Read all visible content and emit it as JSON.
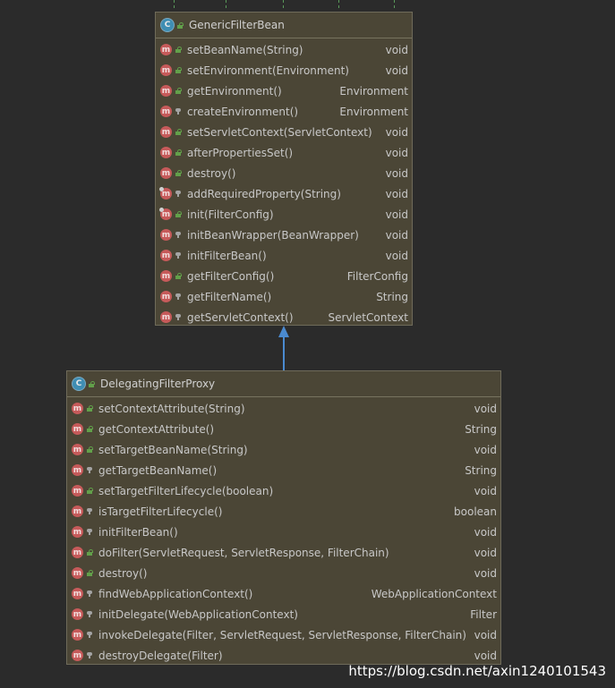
{
  "parent": {
    "name": "GenericFilterBean",
    "kind_glyph": "C",
    "members": [
      {
        "name": "setBeanName(String)",
        "type": "void",
        "access": "open",
        "override": false
      },
      {
        "name": "setEnvironment(Environment)",
        "type": "void",
        "access": "open",
        "override": false
      },
      {
        "name": "getEnvironment()",
        "type": "Environment",
        "access": "open",
        "override": false
      },
      {
        "name": "createEnvironment()",
        "type": "Environment",
        "access": "lock",
        "override": false
      },
      {
        "name": "setServletContext(ServletContext)",
        "type": "void",
        "access": "open",
        "override": false
      },
      {
        "name": "afterPropertiesSet()",
        "type": "void",
        "access": "open",
        "override": false
      },
      {
        "name": "destroy()",
        "type": "void",
        "access": "open",
        "override": false
      },
      {
        "name": "addRequiredProperty(String)",
        "type": "void",
        "access": "lock",
        "override": true
      },
      {
        "name": "init(FilterConfig)",
        "type": "void",
        "access": "open",
        "override": true
      },
      {
        "name": "initBeanWrapper(BeanWrapper)",
        "type": "void",
        "access": "lock",
        "override": false
      },
      {
        "name": "initFilterBean()",
        "type": "void",
        "access": "lock",
        "override": false
      },
      {
        "name": "getFilterConfig()",
        "type": "FilterConfig",
        "access": "open",
        "override": false
      },
      {
        "name": "getFilterName()",
        "type": "String",
        "access": "lock",
        "override": false
      },
      {
        "name": "getServletContext()",
        "type": "ServletContext",
        "access": "lock",
        "override": false
      }
    ]
  },
  "child": {
    "name": "DelegatingFilterProxy",
    "kind_glyph": "C",
    "members": [
      {
        "name": "setContextAttribute(String)",
        "type": "void",
        "access": "open"
      },
      {
        "name": "getContextAttribute()",
        "type": "String",
        "access": "open"
      },
      {
        "name": "setTargetBeanName(String)",
        "type": "void",
        "access": "open"
      },
      {
        "name": "getTargetBeanName()",
        "type": "String",
        "access": "lock"
      },
      {
        "name": "setTargetFilterLifecycle(boolean)",
        "type": "void",
        "access": "open"
      },
      {
        "name": "isTargetFilterLifecycle()",
        "type": "boolean",
        "access": "lock"
      },
      {
        "name": "initFilterBean()",
        "type": "void",
        "access": "lock"
      },
      {
        "name": "doFilter(ServletRequest, ServletResponse, FilterChain)",
        "type": "void",
        "access": "open"
      },
      {
        "name": "destroy()",
        "type": "void",
        "access": "open"
      },
      {
        "name": "findWebApplicationContext()",
        "type": "WebApplicationContext",
        "access": "lock"
      },
      {
        "name": "initDelegate(WebApplicationContext)",
        "type": "Filter",
        "access": "lock"
      },
      {
        "name": "invokeDelegate(Filter, ServletRequest, ServletResponse, FilterChain)",
        "type": "void",
        "access": "lock"
      },
      {
        "name": "destroyDelegate(Filter)",
        "type": "void",
        "access": "lock"
      }
    ]
  },
  "method_glyph": "m",
  "watermark": "https://blog.csdn.net/axin1240101543",
  "colors": {
    "background": "#2b2b2b",
    "class_box": "#4b4636",
    "method_icon": "#c65a5a",
    "class_icon": "#3f8eb3",
    "inheritance_arrow": "#4a8ad0"
  }
}
